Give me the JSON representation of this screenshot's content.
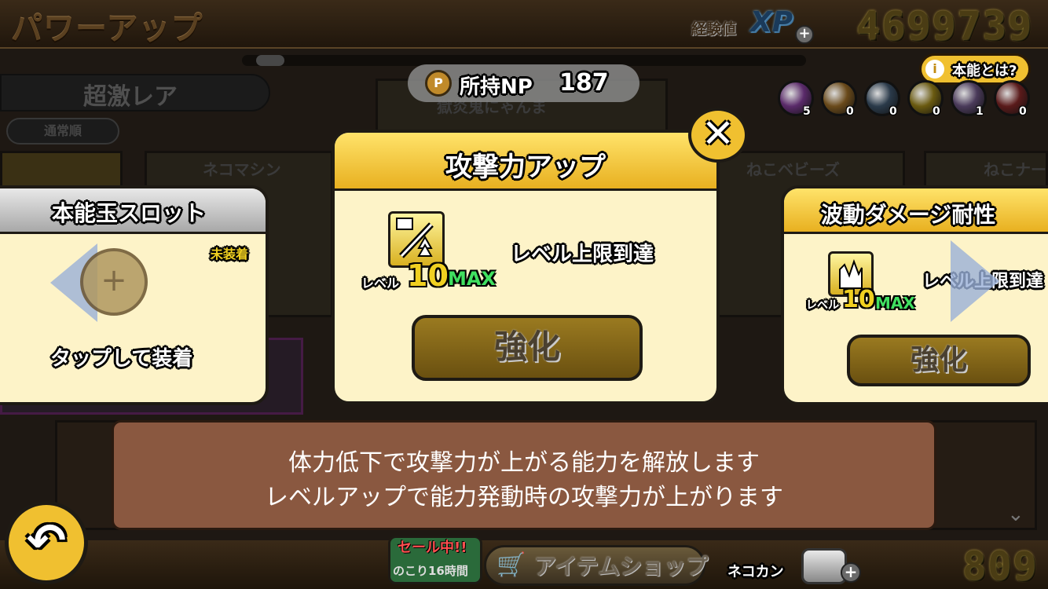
{
  "header": {
    "title": "パワーアップ",
    "xp_label": "経験値",
    "xp_badge": "XP",
    "xp_value": "4699739"
  },
  "background": {
    "rarity": "超激レア",
    "sort_label": "通常順",
    "card_names": [
      "ネコマシン",
      "ねこベビーズ",
      "ねこナー"
    ],
    "featured_card_name": "獄炎鬼にゃんま"
  },
  "np": {
    "label": "所持NP",
    "value": "187"
  },
  "info_button": {
    "label": "本能とは?"
  },
  "orbs": [
    {
      "color": "#5a2a6a",
      "count": "5"
    },
    {
      "color": "#6a4a1a",
      "count": "0"
    },
    {
      "color": "#2a3a4a",
      "count": "0"
    },
    {
      "color": "#6a5a10",
      "count": "0"
    },
    {
      "color": "#4a3a5a",
      "count": "1"
    },
    {
      "color": "#5a1a1a",
      "count": "0"
    }
  ],
  "slot_panel": {
    "title": "本能玉スロット",
    "status": "未装着",
    "hint": "タップして装着"
  },
  "main_panel": {
    "title": "攻撃力アップ",
    "level_label": "レベル",
    "level": "10",
    "max_label": "MAX",
    "status": "レベル上限到達",
    "button": "強化"
  },
  "right_panel": {
    "title": "波動ダメージ耐性",
    "level_label": "レベル",
    "level": "10",
    "max_label": "MAX",
    "status": "レベル上限到達",
    "button": "強化"
  },
  "description": {
    "line1": "体力低下で攻撃力が上がる能力を解放します",
    "line2": "レベルアップで能力発動時の攻撃力が上がります"
  },
  "footer": {
    "sale_label": "セール中!!",
    "sale_remaining": "のこり16時間",
    "shop_label": "アイテムショップ",
    "catfood_label": "ネコカン",
    "catfood_value": "809"
  },
  "colors": {
    "accent_gold": "#f0c030",
    "panel_cream": "#fdf3c8",
    "max_green": "#40e060",
    "description_bg": "#8a5840"
  }
}
